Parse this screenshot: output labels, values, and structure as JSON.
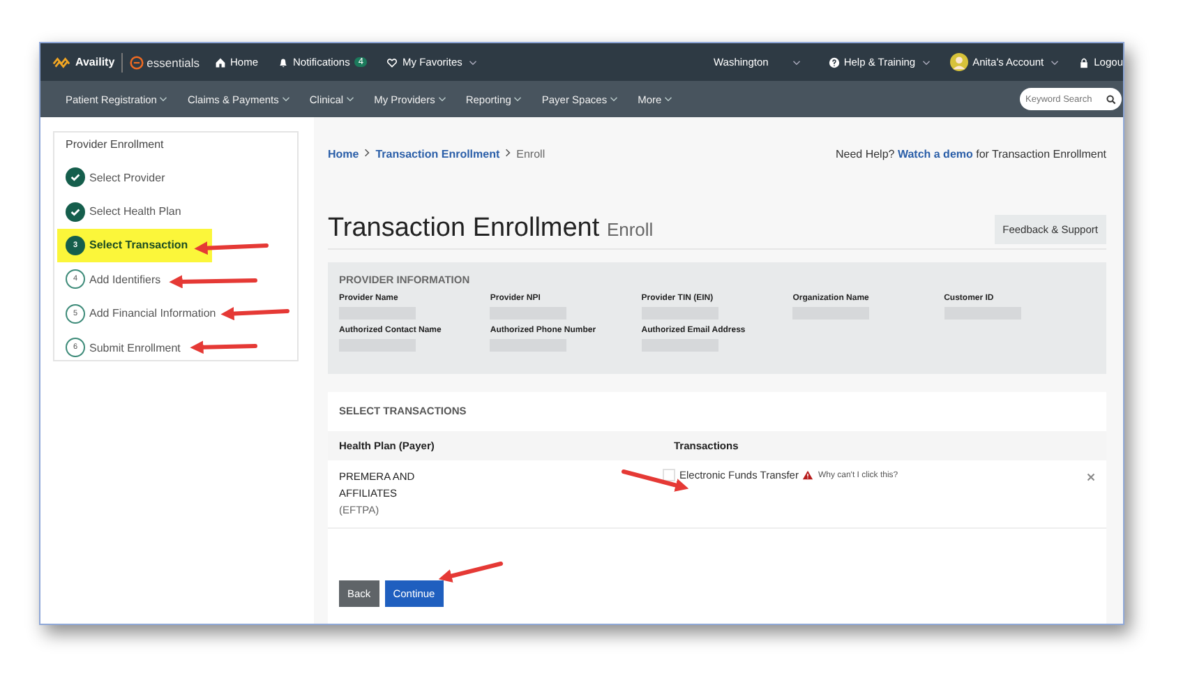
{
  "top_nav": {
    "brand": "Availity",
    "product": "essentials",
    "links": [
      {
        "label": "Home"
      },
      {
        "label": "Notifications",
        "badge": "4"
      },
      {
        "label": "My Favorites",
        "caret": true
      }
    ],
    "region": "Washington",
    "help": "Help & Training",
    "account": "Anita's Account",
    "logout": "Logou"
  },
  "main_nav": {
    "items": [
      "Patient Registration",
      "Claims & Payments",
      "Clinical",
      "My Providers",
      "Reporting",
      "Payer Spaces",
      "More"
    ],
    "search": {
      "placeholder": "Keyword Search"
    }
  },
  "sidebar": {
    "title": "Provider Enrollment",
    "steps": [
      {
        "label": "Select Provider",
        "completed": true,
        "selected": false
      },
      {
        "label": "Select Health Plan",
        "completed": true,
        "selected": false
      },
      {
        "label": "Select Transaction",
        "completed": false,
        "selected": true,
        "number": "3"
      },
      {
        "label": "Add Identifiers",
        "completed": false,
        "selected": false,
        "number": "4"
      },
      {
        "label": "Add Financial Information",
        "completed": false,
        "selected": false,
        "number": "5"
      },
      {
        "label": "Submit Enrollment",
        "completed": false,
        "selected": false,
        "number": "6"
      }
    ]
  },
  "breadcrumb": [
    {
      "label": "Home",
      "link": true
    },
    {
      "label": "Transaction Enrollment",
      "link": true
    },
    {
      "label": "Enroll",
      "link": false
    }
  ],
  "help": {
    "prefix": "Need Help?",
    "link": "Watch a demo",
    "suffix": "for Transaction Enrollment"
  },
  "page_title": "Transaction Enrollment",
  "page_subtitle": "Enroll",
  "feedback_button": "Feedback & Support",
  "provider_info": {
    "heading": "PROVIDER INFORMATION",
    "fields": [
      {
        "label": "Provider Name"
      },
      {
        "label": "Provider NPI"
      },
      {
        "label": "Provider TIN (EIN)"
      },
      {
        "label": "Organization Name"
      },
      {
        "label": "Customer ID"
      },
      {
        "label": "Authorized Contact Name"
      },
      {
        "label": "Authorized Phone Number"
      },
      {
        "label": "Authorized Email Address"
      }
    ]
  },
  "transactions": {
    "heading": "SELECT TRANSACTIONS",
    "columns": [
      "Health Plan (Payer)",
      "Transactions"
    ],
    "rows": [
      {
        "payer": "PREMERA AND AFFILIATES",
        "payer_code": "(EFTPA)",
        "transaction": "Electronic Funds Transfer",
        "checked": false,
        "disabled": true,
        "warning": "Why can't I click this?"
      }
    ]
  },
  "buttons": [
    {
      "label": "Back",
      "kind": "secondary"
    },
    {
      "label": "Continue",
      "kind": "primary"
    }
  ]
}
